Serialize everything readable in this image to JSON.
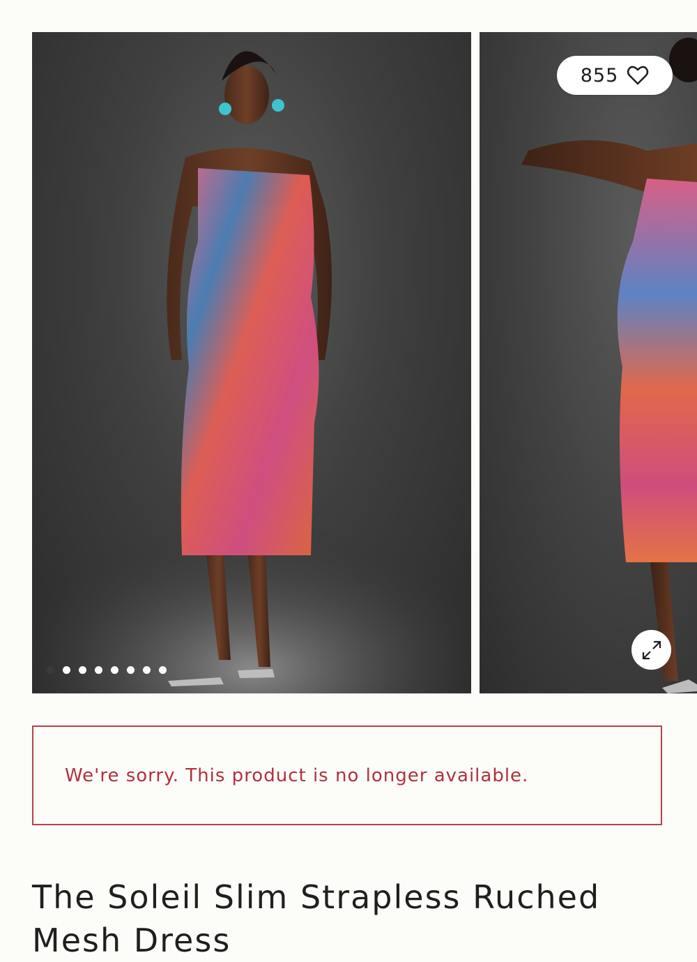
{
  "gallery": {
    "likes": "855",
    "like_icon": "heart-outline-icon",
    "expand_icon": "expand-arrows-icon",
    "slide_count": 8,
    "active_slide": 1,
    "images": [
      {
        "description_name": "product-image-front"
      },
      {
        "description_name": "product-image-back"
      }
    ]
  },
  "alert": {
    "message": "We're sorry. This product is no longer available."
  },
  "product": {
    "title": "The Soleil Slim Strapless Ruched Mesh Dress"
  },
  "colors": {
    "alert": "#b0313b",
    "background": "#fcfcf9",
    "text": "#1f1f1f"
  }
}
